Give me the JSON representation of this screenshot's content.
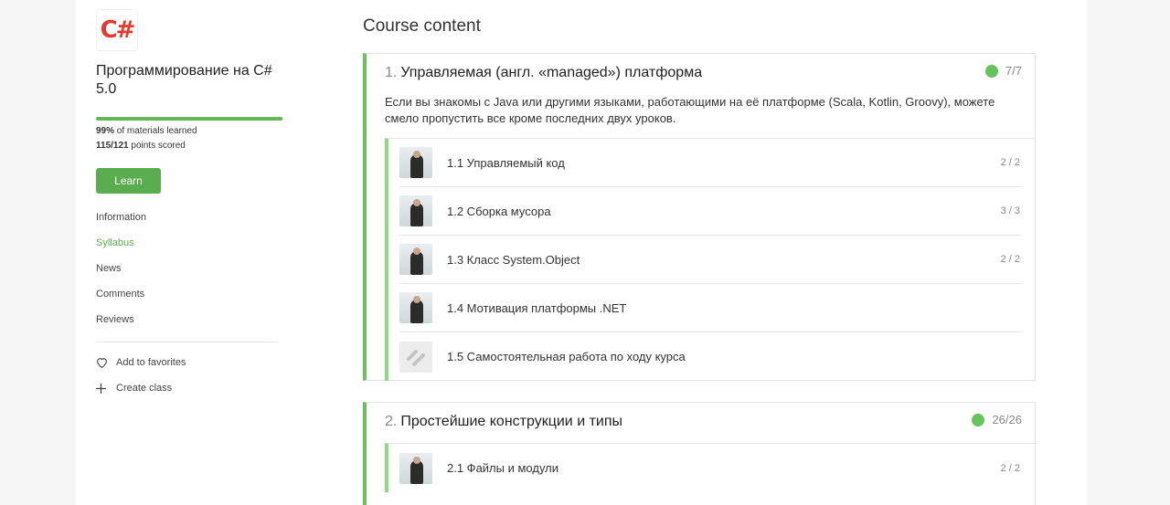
{
  "sidebar": {
    "logo_text": "C#",
    "course_title": "Программирование на C# 5.0",
    "progress_percent": 99,
    "materials_pct": "99%",
    "materials_label": "of materials learned",
    "points_value": "115/121",
    "points_label": "points scored",
    "learn_label": "Learn",
    "nav": [
      "Information",
      "Syllabus",
      "News",
      "Comments",
      "Reviews"
    ],
    "active_nav": "Syllabus",
    "add_favorites": "Add to favorites",
    "create_class": "Create class"
  },
  "main": {
    "heading": "Course content",
    "modules": [
      {
        "num": "1.",
        "title": "Управляемая (англ. «managed») платформа",
        "status": "7/7",
        "description": "Если вы знакомы с Java или другими языками, работающими на её платформе (Scala, Kotlin, Groovy), можете смело пропустить все кроме последних двух уроков.",
        "lessons": [
          {
            "title": "1.1 Управляемый код",
            "score": "2 / 2"
          },
          {
            "title": "1.2 Сборка мусора",
            "score": "3 / 3"
          },
          {
            "title": "1.3 Класс System.Object",
            "score": "2 / 2"
          },
          {
            "title": "1.4 Мотивация платформы .NET",
            "score": ""
          },
          {
            "title": "1.5 Самостоятельная работа по ходу курса",
            "score": ""
          }
        ]
      },
      {
        "num": "2.",
        "title": "Простейшие конструкции и типы",
        "status": "26/26",
        "lessons": [
          {
            "title": "2.1 Файлы и модули",
            "score": "2 / 2"
          }
        ]
      }
    ]
  },
  "colors": {
    "accent": "#5aad4e",
    "module_border": "#66c25a",
    "lesson_border": "#8fd985",
    "logo_red": "#e63a2e"
  }
}
